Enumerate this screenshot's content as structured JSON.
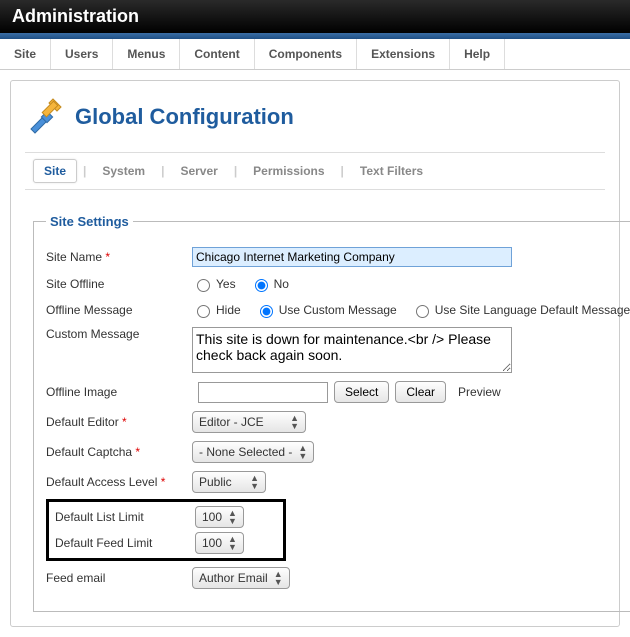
{
  "header": {
    "title": "Administration"
  },
  "menu": {
    "items": [
      "Site",
      "Users",
      "Menus",
      "Content",
      "Components",
      "Extensions",
      "Help"
    ]
  },
  "pageTitle": "Global Configuration",
  "tabs": [
    "Site",
    "System",
    "Server",
    "Permissions",
    "Text Filters"
  ],
  "activeTabIndex": 0,
  "legend": "Site Settings",
  "labels": {
    "siteName": "Site Name",
    "siteOffline": "Site Offline",
    "offlineMessage": "Offline Message",
    "customMessage": "Custom Message",
    "offlineImage": "Offline Image",
    "defaultEditor": "Default Editor",
    "defaultCaptcha": "Default Captcha",
    "defaultAccessLevel": "Default Access Level",
    "defaultListLimit": "Default List Limit",
    "defaultFeedLimit": "Default Feed Limit",
    "feedEmail": "Feed email",
    "yes": "Yes",
    "no": "No",
    "hide": "Hide",
    "useCustom": "Use Custom Message",
    "useSiteLang": "Use Site Language Default Message",
    "select": "Select",
    "clear": "Clear",
    "preview": "Preview",
    "required": "*"
  },
  "values": {
    "siteName": "Chicago Internet Marketing Company",
    "siteOffline": "No",
    "offlineMessage": "Use Custom Message",
    "customMessage": "This site is down for maintenance.<br /> Please check back again soon.",
    "offlineImage": "",
    "defaultEditor": "Editor - JCE",
    "defaultCaptcha": "- None Selected -",
    "defaultAccessLevel": "Public",
    "defaultListLimit": "100",
    "defaultFeedLimit": "100",
    "feedEmail": "Author Email"
  }
}
